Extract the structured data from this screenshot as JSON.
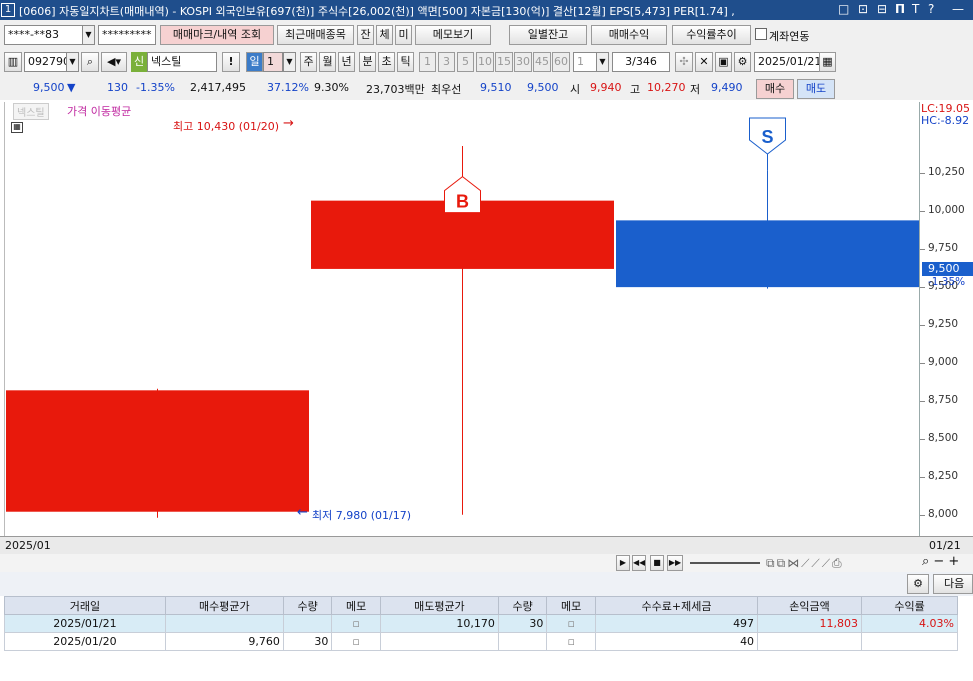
{
  "window": {
    "number": "1",
    "title": "[0606] 자동일지차트(매매내역) - KOSPI 외국인보유[697(천)] 주식수[26,002(천)] 액면[500] 자본금[130(억)] 결산[12월] EPS[5,473] PER[1.74] ,",
    "controls": [
      "□",
      "⊡",
      "⊟",
      "𝝥",
      "T",
      "?",
      "—"
    ]
  },
  "toolbar1": {
    "account": "****-**83",
    "password": "*********",
    "btn_trade_mark": "매매마크/내역 조회",
    "btn_recent": "최근매매종목",
    "btn_jan": "잔",
    "btn_che": "체",
    "btn_mi": "미",
    "btn_memo": "메모보기",
    "btn_daily": "일별잔고",
    "btn_profit": "매매수익",
    "btn_return": "수익률추이",
    "chk_link": "계좌연동"
  },
  "toolbar2": {
    "code": "092790",
    "badge": "신",
    "name": "넥스틸",
    "excl": "!",
    "period_sel": "일",
    "period_num": "1",
    "periods": [
      "주",
      "월",
      "년",
      "분",
      "초",
      "틱"
    ],
    "minutes": [
      "1",
      "3",
      "5",
      "10",
      "15",
      "30",
      "45",
      "60"
    ],
    "count": "1",
    "page": "3",
    "total": "/346",
    "date": "2025/01/21"
  },
  "quote": {
    "price": "9,500",
    "arrow": "▼",
    "change": "130",
    "pct": "-1.35%",
    "volume": "2,417,495",
    "vol_pct": "37.12%",
    "turnover": "9.30%",
    "amount": "23,703백만",
    "pref_label": "최우선",
    "ask": "9,510",
    "bid": "9,500",
    "open_label": "시",
    "open": "9,940",
    "high_label": "고",
    "high": "10,270",
    "low_label": "저",
    "low": "9,490",
    "buy": "매수",
    "sell": "매도"
  },
  "chart_data": {
    "type": "candlestick",
    "legend": "가격 이동평균",
    "legend_tag": "넥스틸",
    "top_right": {
      "lc": "LC:19.05",
      "hc": "HC:-8.92"
    },
    "candles": [
      {
        "date": "2025/01/17",
        "open": 8820,
        "high": 8830,
        "low": 7980,
        "close": 8020
      },
      {
        "date": "2025/01/20",
        "open": 10070,
        "high": 10430,
        "low": 8000,
        "close": 9620
      },
      {
        "date": "2025/01/21",
        "open": 9940,
        "high": 10270,
        "low": 9490,
        "close": 9500
      }
    ],
    "ylim": [
      7860,
      10720
    ],
    "yticks": [
      "10,250",
      "10,000",
      "9,750",
      "9,500",
      "9,250",
      "9,000",
      "8,750",
      "8,500",
      "8,250",
      "8,000"
    ],
    "high_label": "최고 10,430 (01/20)",
    "low_label": "최저 7,980 (01/17)",
    "buy_mark": "B",
    "sell_mark": "S",
    "current": "9,500",
    "current_pct": "-1.35%",
    "x_start": "2025/01",
    "x_end": "01/21"
  },
  "table": {
    "next": "다음",
    "headers": [
      "거래일",
      "매수평균가",
      "수량",
      "메모",
      "매도평균가",
      "수량",
      "메모",
      "수수료+제세금",
      "손익금액",
      "수익률"
    ],
    "rows": [
      [
        "2025/01/21",
        "",
        "",
        "",
        "10,170",
        "30",
        "",
        "497",
        "11,803",
        "4.03%"
      ],
      [
        "2025/01/20",
        "9,760",
        "30",
        "",
        "",
        "",
        "",
        "40",
        "",
        ""
      ]
    ]
  }
}
